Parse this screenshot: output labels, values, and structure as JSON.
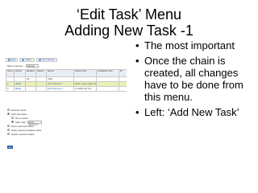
{
  "slide": {
    "title_line1": "‘Edit Task’ Menu",
    "title_line2": "Adding New Task -1",
    "bullets": [
      "The most important",
      "Once the chain is created, all changes have to be done from this menu.",
      "Left: ‘Add New Task’"
    ],
    "bullet_glyph": "•"
  },
  "screenshot": {
    "crumbs": [
      "Eng",
      "Task 1",
      "Find Source"
    ],
    "menu_label": "Menu controls:",
    "menu_value": "Source",
    "columns": [
      "Sort order",
      "Action",
      "Default",
      "Select",
      "Name",
      "Source file",
      "Available from",
      "Pr"
    ],
    "filter_row": [
      "",
      "",
      "All",
      "",
      "Task",
      "",
      "",
      ""
    ],
    "rows": [
      [
        "1",
        "[Edit]",
        "",
        "",
        "Find Source 1",
        "Hmm: Lore, Ipsu Adsum",
        "",
        ""
      ],
      [
        "2",
        "[Edit]",
        "",
        "",
        "Find Source 2",
        "Conditional Tra",
        "",
        ""
      ]
    ],
    "options": [
      "Reorder tasks",
      "Add new tasks",
      "Run a chain",
      "After task",
      "Move selected tasks",
      "Apply selected default tasks",
      "Delete selected tasks"
    ],
    "after_task_value": "Find Source 1",
    "go_label": "Go"
  }
}
